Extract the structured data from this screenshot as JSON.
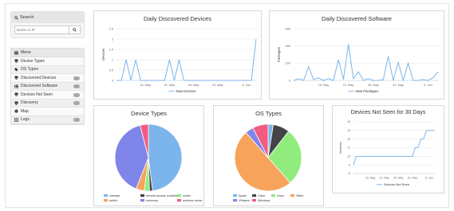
{
  "sidebar": {
    "search_title": "Search",
    "search_placeholder": "Name or IP",
    "menu_title": "Menu",
    "items": [
      {
        "label": "Device Types",
        "badge": false
      },
      {
        "label": "OS Types",
        "badge": false
      },
      {
        "label": "Discovered Devices",
        "badge": true
      },
      {
        "label": "Discovered Software",
        "badge": true
      },
      {
        "label": "Devices Not Seen",
        "badge": true
      },
      {
        "label": "Discovery",
        "badge": true
      },
      {
        "label": "Map",
        "badge": false
      },
      {
        "label": "Logs",
        "badge": true
      }
    ]
  },
  "colors": {
    "line": "#7cb5ec",
    "badge": "#a9a9a9"
  },
  "chart_data": [
    {
      "id": "devices",
      "type": "line",
      "title": "Daily Discovered Devices",
      "ylabel": "Devices",
      "legend": "New Devices",
      "legend_position": "bottom",
      "ylim": [
        0,
        2.5
      ],
      "yticks": [
        "0",
        "0.5",
        "1",
        "1.5",
        "2",
        "2.5"
      ],
      "xticks": [
        {
          "label": "16. May",
          "at": 6
        },
        {
          "label": "21. May",
          "at": 11
        },
        {
          "label": "26. May",
          "at": 16
        },
        {
          "label": "31. May",
          "at": 21
        },
        {
          "label": "6. Jun",
          "at": 27
        }
      ],
      "series": [
        {
          "name": "New Devices",
          "values": [
            0,
            0,
            1,
            0,
            1,
            0,
            0,
            0,
            0,
            0,
            0,
            1,
            0,
            1,
            0,
            0,
            0,
            0,
            0,
            0,
            0,
            0,
            0,
            0,
            0,
            0,
            0,
            0,
            0,
            2
          ]
        }
      ]
    },
    {
      "id": "software",
      "type": "line",
      "title": "Daily Discovered Software",
      "ylabel": "Packages",
      "legend": "New Packages",
      "legend_position": "bottom",
      "ylim": [
        0,
        600
      ],
      "yticks": [
        "0",
        "200",
        "400",
        "600"
      ],
      "xticks": [
        {
          "label": "16. May",
          "at": 6
        },
        {
          "label": "21. May",
          "at": 11
        },
        {
          "label": "26. May",
          "at": 16
        },
        {
          "label": "31. May",
          "at": 21
        },
        {
          "label": "6. Jun",
          "at": 27
        }
      ],
      "series": [
        {
          "name": "New Packages",
          "values": [
            0,
            20,
            0,
            160,
            10,
            30,
            0,
            20,
            0,
            240,
            10,
            420,
            20,
            100,
            0,
            20,
            0,
            0,
            10,
            280,
            0,
            210,
            0,
            200,
            0,
            0,
            10,
            0,
            30,
            100
          ]
        }
      ]
    },
    {
      "id": "device_types",
      "type": "pie",
      "title": "Device Types",
      "legend_position": "bottom",
      "slices": [
        {
          "label": "vmware",
          "value": 48,
          "color": "#7cb5ec"
        },
        {
          "label": "remote access controller",
          "value": 1.5,
          "color": "#434348"
        },
        {
          "label": "router",
          "value": 2.5,
          "color": "#90ed7d"
        },
        {
          "label": "switch",
          "value": 4,
          "color": "#f7a35c"
        },
        {
          "label": "unknown",
          "value": 40,
          "color": "#8085e9"
        },
        {
          "label": "wireless router",
          "value": 4,
          "color": "#f15c80"
        }
      ],
      "legend_order": [
        "vmware",
        "remote access controller",
        "router",
        "switch",
        "unknown",
        "wireless router"
      ]
    },
    {
      "id": "os_types",
      "type": "pie",
      "title": "OS Types",
      "legend_position": "bottom",
      "slices": [
        {
          "label": "Apple",
          "value": 2.5,
          "color": "#7cb5ec"
        },
        {
          "label": "Cisco",
          "value": 8,
          "color": "#434348"
        },
        {
          "label": "Linux",
          "value": 28,
          "color": "#90ed7d"
        },
        {
          "label": "Other",
          "value": 50,
          "color": "#f7a35c"
        },
        {
          "label": "VMware",
          "value": 4,
          "color": "#8085e9"
        },
        {
          "label": "Windows",
          "value": 7.5,
          "color": "#f15c80"
        }
      ],
      "legend_order": [
        "Apple",
        "Cisco",
        "Linux",
        "Other",
        "VMware",
        "Windows"
      ]
    },
    {
      "id": "not_seen",
      "type": "line",
      "title": "Devices Not Seen for 30 Days",
      "ylabel": "Devices",
      "legend": "Devices Not Seen",
      "legend_position": "bottom",
      "ylim": [
        8,
        14
      ],
      "yticks": [
        "8",
        "9",
        "10",
        "11",
        "12",
        "13",
        "14"
      ],
      "xticks": [
        {
          "label": "16. May",
          "at": 6
        },
        {
          "label": "21. May",
          "at": 11
        },
        {
          "label": "26. May",
          "at": 16
        },
        {
          "label": "31. May",
          "at": 21
        },
        {
          "label": "6. Jun",
          "at": 27
        }
      ],
      "series": [
        {
          "name": "Devices Not Seen",
          "values": [
            9,
            10,
            10,
            10,
            10,
            10,
            10,
            10,
            10,
            10,
            10,
            10,
            10,
            10,
            10,
            10,
            10,
            10,
            10,
            10,
            10,
            10,
            11,
            11,
            12,
            12,
            13,
            13,
            13,
            13
          ]
        }
      ]
    }
  ]
}
